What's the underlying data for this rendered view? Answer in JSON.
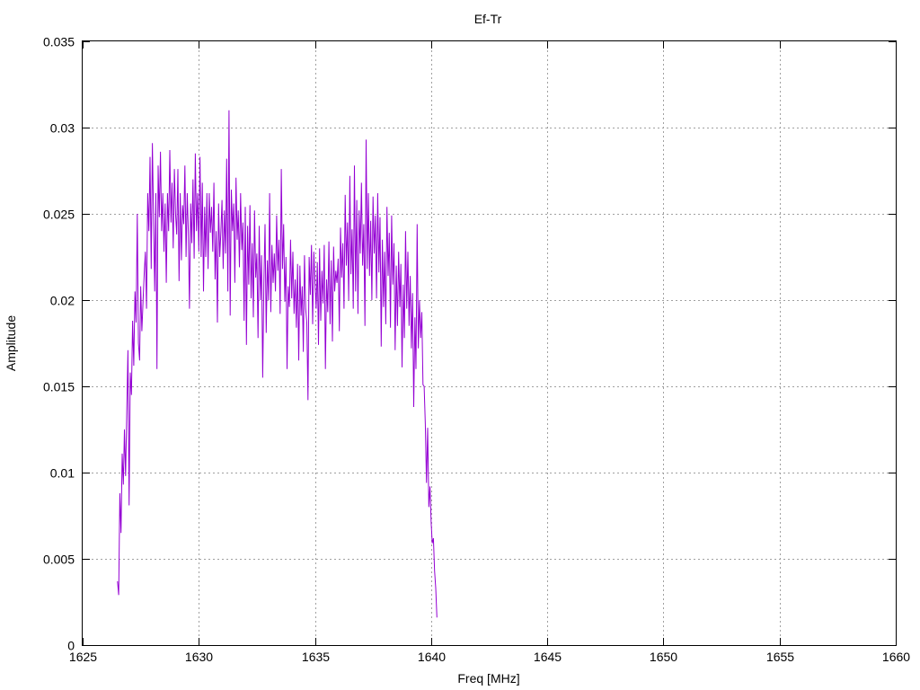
{
  "chart_data": {
    "type": "line",
    "title": "Ef-Tr",
    "xlabel": "Freq [MHz]",
    "ylabel": "Amplitude",
    "xlim": [
      1625,
      1660
    ],
    "ylim": [
      0,
      0.035
    ],
    "xticks": [
      1625,
      1630,
      1635,
      1640,
      1645,
      1650,
      1655,
      1660
    ],
    "xtick_labels": [
      "1625",
      "1630",
      "1635",
      "1640",
      "1645",
      "1650",
      "1655",
      "1660"
    ],
    "yticks": [
      0,
      0.005,
      0.01,
      0.015,
      0.02,
      0.025,
      0.03,
      0.035
    ],
    "ytick_labels": [
      "0",
      "0.005",
      "0.01",
      "0.015",
      "0.02",
      "0.025",
      "0.03",
      "0.035"
    ],
    "grid": true,
    "legend": "none",
    "series_color": "#9400d3",
    "series": [
      {
        "x_start": 1626.5,
        "x_step": 0.05,
        "values": [
          0.0037,
          0.0029,
          0.0088,
          0.0065,
          0.0111,
          0.0093,
          0.0125,
          0.0098,
          0.0135,
          0.0171,
          0.0081,
          0.0158,
          0.0145,
          0.0188,
          0.0162,
          0.0205,
          0.0187,
          0.025,
          0.0175,
          0.0165,
          0.0208,
          0.0182,
          0.0199,
          0.0215,
          0.0228,
          0.0195,
          0.0262,
          0.024,
          0.0283,
          0.0218,
          0.0291,
          0.0248,
          0.0205,
          0.0262,
          0.016,
          0.0278,
          0.0248,
          0.0286,
          0.024,
          0.0262,
          0.0228,
          0.0256,
          0.021,
          0.0262,
          0.024,
          0.0287,
          0.0245,
          0.0268,
          0.023,
          0.0276,
          0.025,
          0.0238,
          0.0276,
          0.0211,
          0.0262,
          0.0223,
          0.0255,
          0.0244,
          0.0278,
          0.0225,
          0.0262,
          0.024,
          0.0195,
          0.0256,
          0.0233,
          0.027,
          0.0224,
          0.0285,
          0.024,
          0.0262,
          0.0228,
          0.0283,
          0.0225,
          0.0268,
          0.0205,
          0.0254,
          0.0225,
          0.0262,
          0.0218,
          0.0262,
          0.0239,
          0.0254,
          0.0228,
          0.0268,
          0.0212,
          0.024,
          0.0187,
          0.0256,
          0.0225,
          0.024,
          0.0258,
          0.0218,
          0.0252,
          0.0227,
          0.0282,
          0.0205,
          0.031,
          0.0191,
          0.0264,
          0.024,
          0.0256,
          0.021,
          0.0271,
          0.0235,
          0.0252,
          0.0219,
          0.0262,
          0.0229,
          0.0245,
          0.0188,
          0.0254,
          0.0174,
          0.0243,
          0.0209,
          0.0255,
          0.0201,
          0.0233,
          0.019,
          0.0252,
          0.0213,
          0.0227,
          0.0178,
          0.0243,
          0.02,
          0.0226,
          0.0155,
          0.021,
          0.0244,
          0.0181,
          0.0223,
          0.02,
          0.0262,
          0.0193,
          0.0232,
          0.021,
          0.0227,
          0.0205,
          0.0249,
          0.0217,
          0.0235,
          0.0192,
          0.0276,
          0.0218,
          0.0244,
          0.0199,
          0.0225,
          0.016,
          0.0208,
          0.0196,
          0.0235,
          0.0201,
          0.0228,
          0.0192,
          0.0212,
          0.0184,
          0.0221,
          0.0165,
          0.022,
          0.0191,
          0.0208,
          0.017,
          0.0226,
          0.0195,
          0.0187,
          0.0142,
          0.0225,
          0.0203,
          0.0232,
          0.0186,
          0.0228,
          0.021,
          0.0195,
          0.0222,
          0.0174,
          0.023,
          0.0188,
          0.0217,
          0.0198,
          0.0232,
          0.016,
          0.0212,
          0.0193,
          0.0234,
          0.0186,
          0.0223,
          0.0176,
          0.0231,
          0.0205,
          0.0217,
          0.021,
          0.0224,
          0.0182,
          0.0242,
          0.0213,
          0.0233,
          0.0195,
          0.0261,
          0.022,
          0.0245,
          0.02,
          0.0272,
          0.0215,
          0.0241,
          0.0195,
          0.0278,
          0.0205,
          0.0258,
          0.0192,
          0.0252,
          0.0227,
          0.0268,
          0.022,
          0.0244,
          0.0185,
          0.0293,
          0.0218,
          0.0262,
          0.0214,
          0.0246,
          0.02,
          0.026,
          0.0227,
          0.0249,
          0.0201,
          0.0262,
          0.0216,
          0.0248,
          0.0173,
          0.0235,
          0.0196,
          0.0228,
          0.0186,
          0.0254,
          0.0214,
          0.0239,
          0.0184,
          0.0249,
          0.0209,
          0.0233,
          0.0171,
          0.022,
          0.0185,
          0.0228,
          0.0196,
          0.0221,
          0.0161,
          0.0209,
          0.0178,
          0.024,
          0.0195,
          0.0228,
          0.0185,
          0.0214,
          0.0172,
          0.0204,
          0.0138,
          0.019,
          0.016,
          0.0244,
          0.0172,
          0.02,
          0.0178,
          0.0193,
          0.0151,
          0.015,
          0.0128,
          0.0094,
          0.0126,
          0.008,
          0.0092,
          0.0071,
          0.0059,
          0.0062,
          0.0043,
          0.0033,
          0.0016
        ]
      }
    ]
  }
}
